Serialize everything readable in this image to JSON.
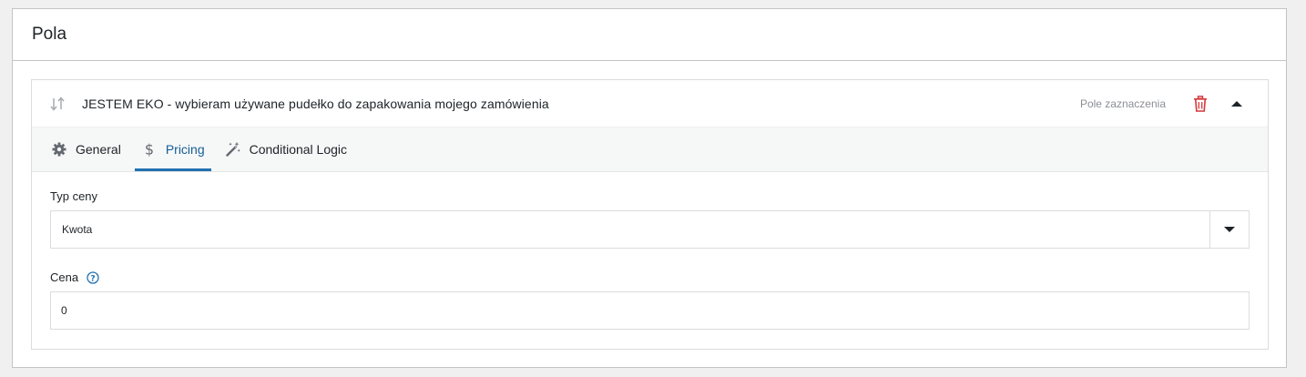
{
  "panel": {
    "title": "Pola"
  },
  "field": {
    "name": "JESTEM EKO - wybieram używane pudełko do zapakowania mojego zamówienia",
    "type_label": "Pole zaznaczenia",
    "icons": {
      "drag": "drag-handle-icon",
      "delete": "trash-icon",
      "collapse": "caret-up-icon"
    },
    "colors": {
      "delete": "#d63638",
      "active_tab": "#2271b1"
    }
  },
  "tabs": [
    {
      "label": "General",
      "icon": "gear-icon",
      "active": false
    },
    {
      "label": "Pricing",
      "icon": "dollar-icon",
      "active": true
    },
    {
      "label": "Conditional Logic",
      "icon": "magic-wand-icon",
      "active": false
    }
  ],
  "form": {
    "price_type": {
      "label": "Typ ceny",
      "value": "Kwota"
    },
    "price": {
      "label": "Cena",
      "value": "0"
    }
  }
}
